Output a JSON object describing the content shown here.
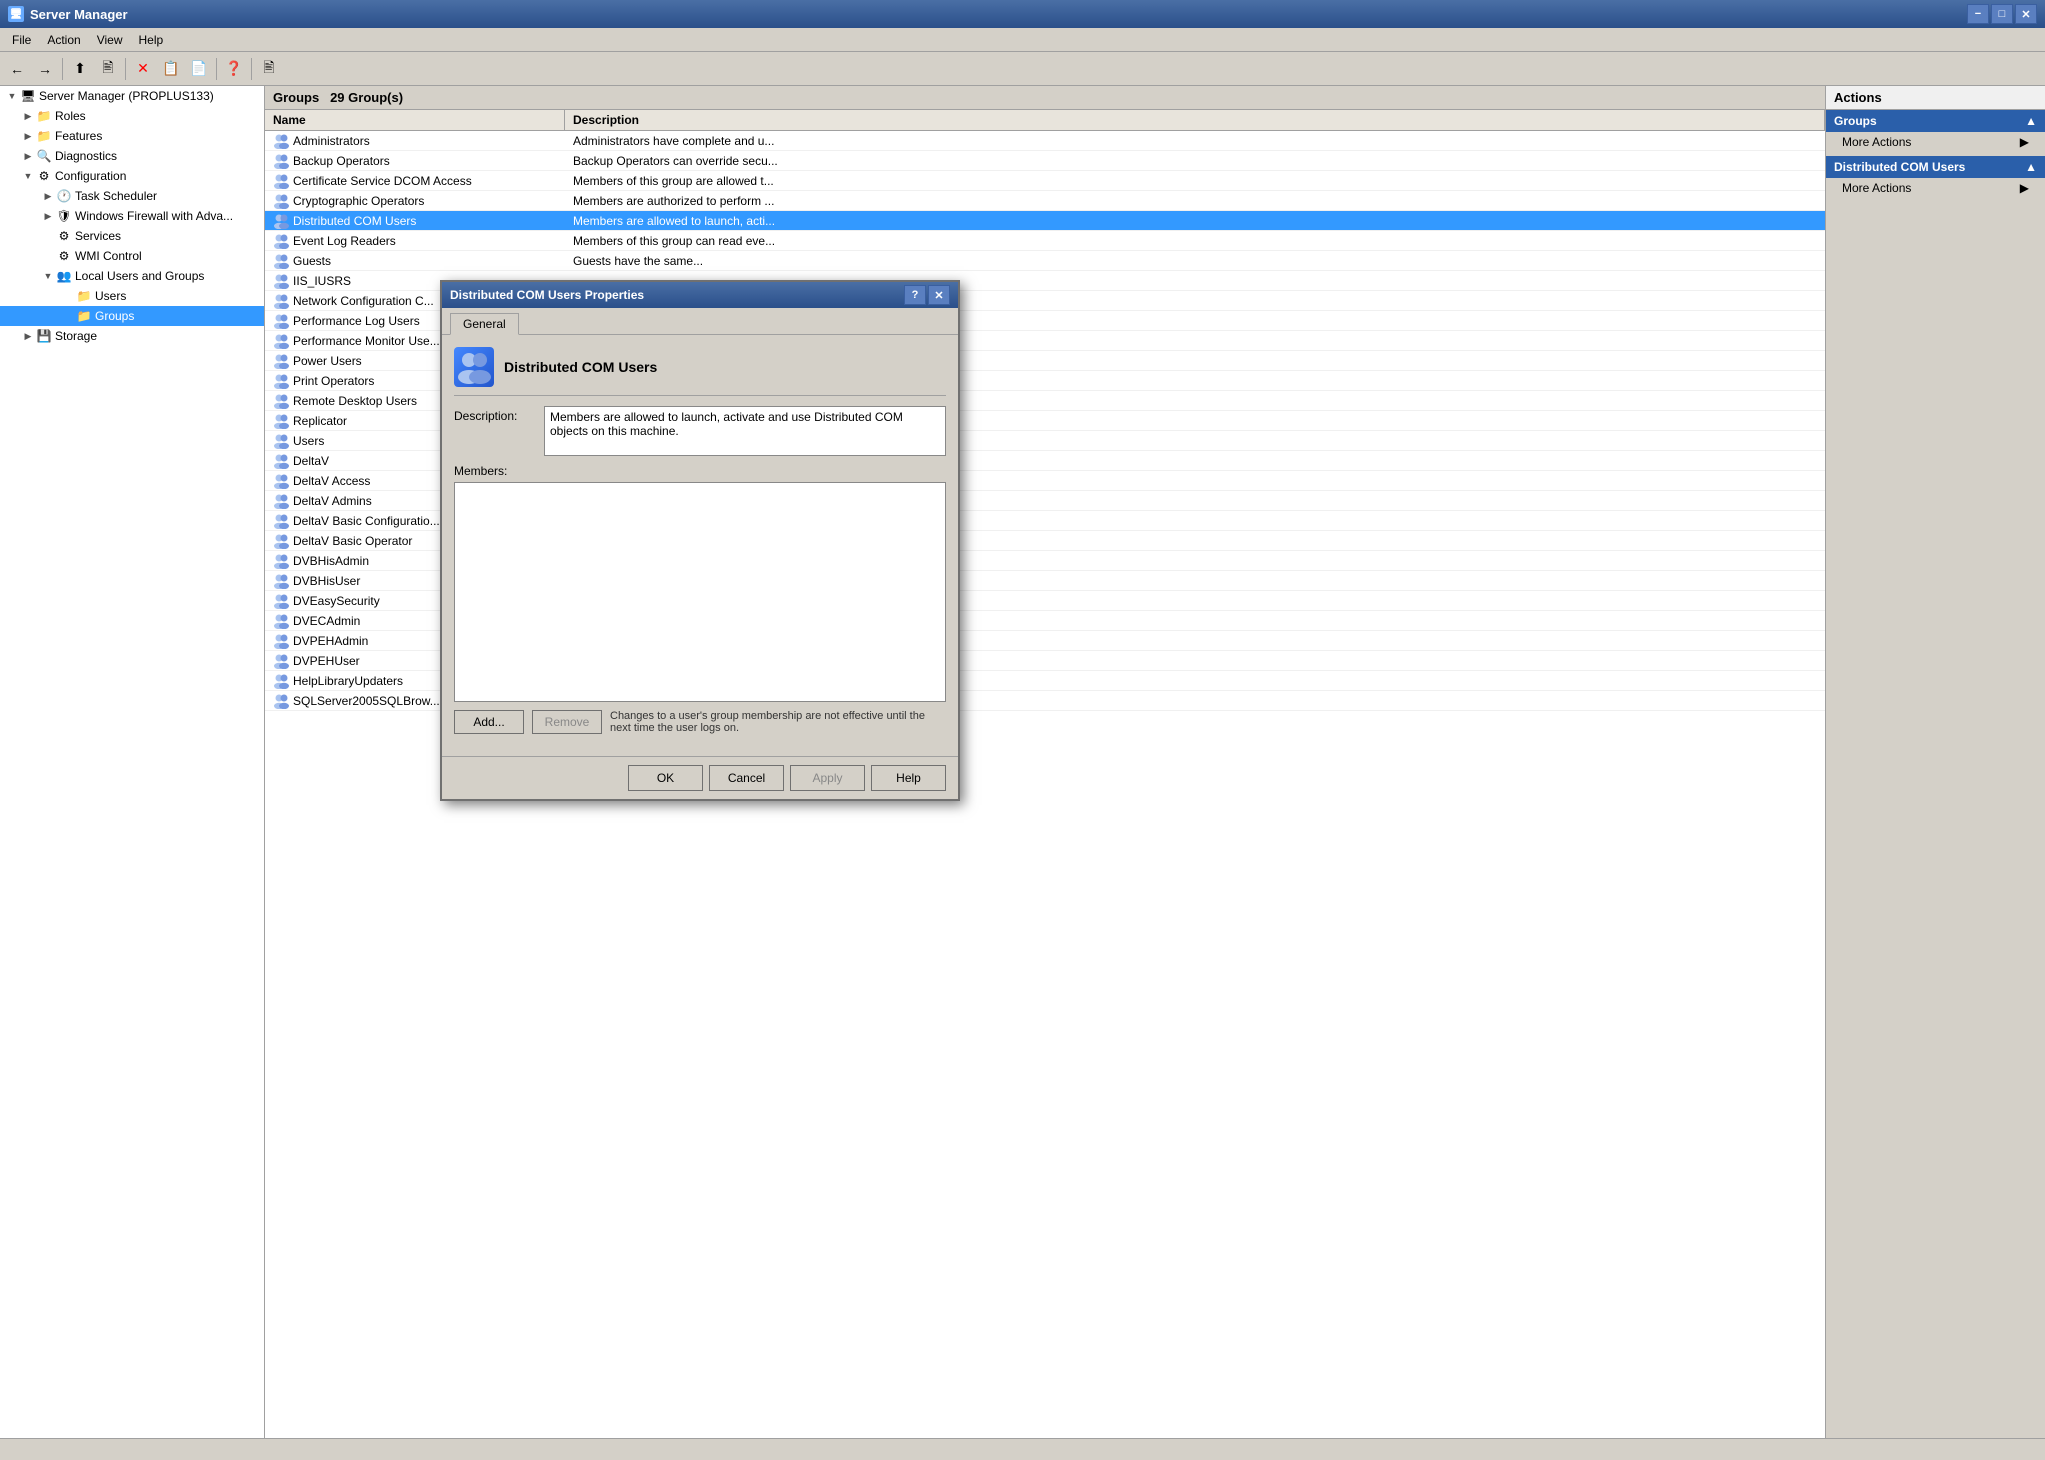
{
  "titlebar": {
    "title": "Server Manager",
    "icon": "🖥",
    "minimize": "−",
    "maximize": "□",
    "close": "✕"
  },
  "menu": {
    "items": [
      "File",
      "Action",
      "View",
      "Help"
    ]
  },
  "toolbar": {
    "buttons": [
      "←",
      "→",
      "⬆",
      "🖹",
      "✕",
      "📋",
      "📄",
      "❓",
      "🖹"
    ]
  },
  "tree": {
    "items": [
      {
        "id": "server-manager",
        "label": "Server Manager (PROPLUS133)",
        "indent": 0,
        "expanded": true,
        "icon": "🖥",
        "hasExpander": true
      },
      {
        "id": "roles",
        "label": "Roles",
        "indent": 1,
        "expanded": false,
        "icon": "📁",
        "hasExpander": true
      },
      {
        "id": "features",
        "label": "Features",
        "indent": 1,
        "expanded": false,
        "icon": "📁",
        "hasExpander": true
      },
      {
        "id": "diagnostics",
        "label": "Diagnostics",
        "indent": 1,
        "expanded": false,
        "icon": "📁",
        "hasExpander": true
      },
      {
        "id": "configuration",
        "label": "Configuration",
        "indent": 1,
        "expanded": true,
        "icon": "⚙",
        "hasExpander": true
      },
      {
        "id": "task-scheduler",
        "label": "Task Scheduler",
        "indent": 2,
        "expanded": false,
        "icon": "🕐",
        "hasExpander": true
      },
      {
        "id": "windows-firewall",
        "label": "Windows Firewall with Adva...",
        "indent": 2,
        "expanded": false,
        "icon": "🛡",
        "hasExpander": true
      },
      {
        "id": "services",
        "label": "Services",
        "indent": 2,
        "expanded": false,
        "icon": "⚙",
        "hasExpander": false
      },
      {
        "id": "wmi-control",
        "label": "WMI Control",
        "indent": 2,
        "expanded": false,
        "icon": "⚙",
        "hasExpander": false
      },
      {
        "id": "local-users-groups",
        "label": "Local Users and Groups",
        "indent": 2,
        "expanded": true,
        "icon": "👥",
        "hasExpander": true
      },
      {
        "id": "users",
        "label": "Users",
        "indent": 3,
        "expanded": false,
        "icon": "📁",
        "hasExpander": false
      },
      {
        "id": "groups",
        "label": "Groups",
        "indent": 3,
        "expanded": false,
        "icon": "📁",
        "hasExpander": false,
        "selected": true
      },
      {
        "id": "storage",
        "label": "Storage",
        "indent": 1,
        "expanded": false,
        "icon": "💾",
        "hasExpander": true
      }
    ]
  },
  "groups_panel": {
    "header": "Groups",
    "count": "29 Group(s)",
    "columns": [
      "Name",
      "Description"
    ],
    "rows": [
      {
        "name": "Administrators",
        "desc": "Administrators have complete and u..."
      },
      {
        "name": "Backup Operators",
        "desc": "Backup Operators can override secu..."
      },
      {
        "name": "Certificate Service DCOM Access",
        "desc": "Members of this group are allowed t..."
      },
      {
        "name": "Cryptographic Operators",
        "desc": "Members are authorized to perform ..."
      },
      {
        "name": "Distributed COM Users",
        "desc": "Members are allowed to launch, acti...",
        "selected": true
      },
      {
        "name": "Event Log Readers",
        "desc": "Members of this group can read eve..."
      },
      {
        "name": "Guests",
        "desc": "Guests have the same..."
      },
      {
        "name": "IIS_IUSRS",
        "desc": ""
      },
      {
        "name": "Network Configuration C...",
        "desc": ""
      },
      {
        "name": "Performance Log Users",
        "desc": ""
      },
      {
        "name": "Performance Monitor Use...",
        "desc": ""
      },
      {
        "name": "Power Users",
        "desc": ""
      },
      {
        "name": "Print Operators",
        "desc": ""
      },
      {
        "name": "Remote Desktop Users",
        "desc": ""
      },
      {
        "name": "Replicator",
        "desc": ""
      },
      {
        "name": "Users",
        "desc": ""
      },
      {
        "name": "DeltaV",
        "desc": ""
      },
      {
        "name": "DeltaV Access",
        "desc": ""
      },
      {
        "name": "DeltaV Admins",
        "desc": ""
      },
      {
        "name": "DeltaV Basic Configuratio...",
        "desc": ""
      },
      {
        "name": "DeltaV Basic Operator",
        "desc": ""
      },
      {
        "name": "DVBHisAdmin",
        "desc": ""
      },
      {
        "name": "DVBHisUser",
        "desc": ""
      },
      {
        "name": "DVEasySecurity",
        "desc": ""
      },
      {
        "name": "DVECAdmin",
        "desc": ""
      },
      {
        "name": "DVPEHAdmin",
        "desc": ""
      },
      {
        "name": "DVPEHUser",
        "desc": ""
      },
      {
        "name": "HelpLibraryUpdaters",
        "desc": ""
      },
      {
        "name": "SQLServer2005SQLBrow...",
        "desc": ""
      }
    ]
  },
  "actions_panel": {
    "header": "Actions",
    "groups_section": {
      "label": "Groups",
      "items": [
        "More Actions"
      ]
    },
    "distributed_com_section": {
      "label": "Distributed COM Users",
      "items": [
        "More Actions"
      ]
    }
  },
  "dialog": {
    "title": "Distributed COM Users Properties",
    "help_btn": "?",
    "close_btn": "✕",
    "tabs": [
      "General"
    ],
    "active_tab": "General",
    "group_name": "Distributed COM Users",
    "group_icon": "👥",
    "description_label": "Description:",
    "description_value": "Members are allowed to launch, activate and use Distributed COM objects on this machine.",
    "members_label": "Members:",
    "members": [],
    "add_btn": "Add...",
    "remove_btn": "Remove",
    "footer_note": "Changes to a user's group membership are not effective until the next time the user logs on.",
    "ok_btn": "OK",
    "cancel_btn": "Cancel",
    "apply_btn": "Apply",
    "help_btn2": "Help"
  },
  "statusbar": {
    "text": ""
  }
}
